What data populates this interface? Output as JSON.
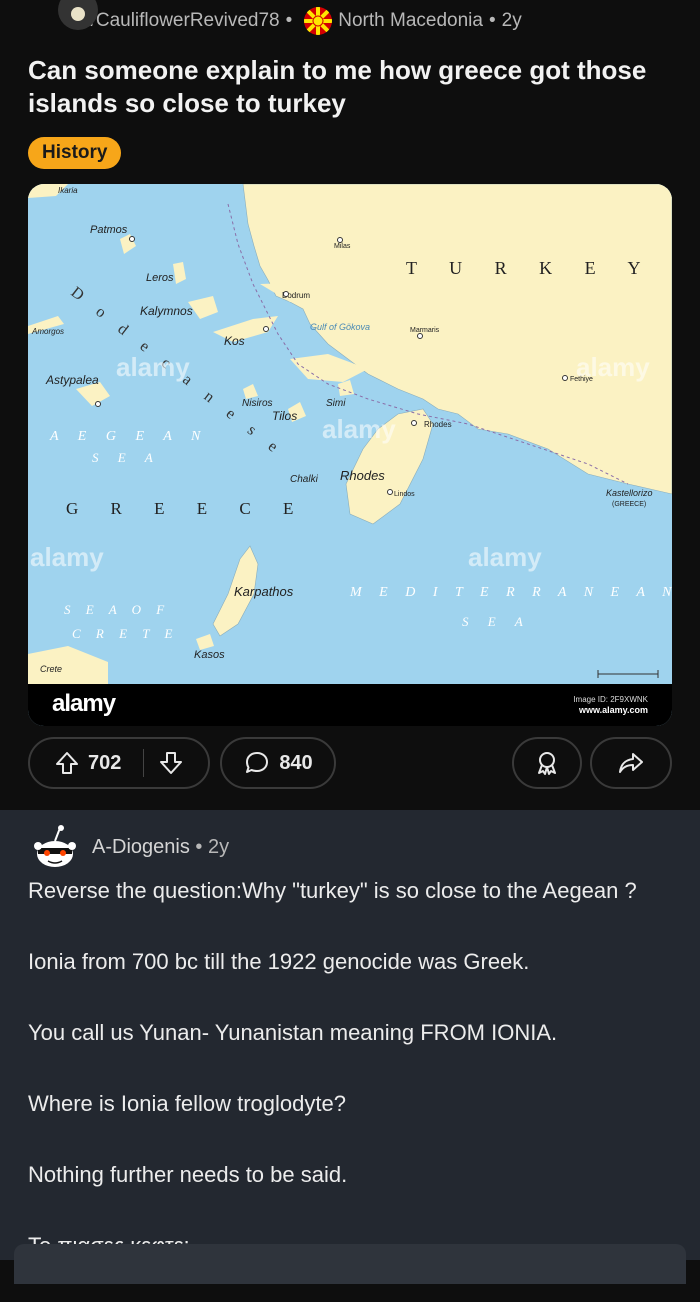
{
  "post": {
    "username": "u/CauliflowerRevived78",
    "dot": "•",
    "location": "North Macedonia",
    "age": "2y",
    "title": "Can someone explain to me how greece got those islands so close to turkey",
    "flair": "History"
  },
  "image": {
    "brand": "alamy",
    "image_id": "Image ID: 2F9XWNK",
    "site": "www.alamy.com",
    "map_labels": {
      "turkey": "T U R K E Y",
      "greece": "G R E E C E",
      "aegean": "A E G E A N",
      "aegean_sea": "S E A",
      "dodecanese": "D o d e c a n e s e",
      "mediterranean": "M E D I T E R R A N E A N",
      "mediterranean_sea": "S E A",
      "sea_of_crete_1": "S E A   O F",
      "sea_of_crete_2": "C R E T E",
      "patmos": "Patmos",
      "leros": "Leros",
      "kalymnos": "Kalymnos",
      "kos": "Kos",
      "astypalea": "Astypalea",
      "nisiros": "Nisiros",
      "tilos": "Tilos",
      "simi": "Simi",
      "rhodes": "Rhodes",
      "chalki": "Chalki",
      "karpathos": "Karpathos",
      "kasos": "Kasos",
      "crete": "Crete",
      "amorgos": "Amorgos",
      "ikaria": "Ikaria",
      "bodrum": "Bodrum",
      "marmaris": "Marmaris",
      "fethiye": "Fethiye",
      "milas": "Milas",
      "lindos": "Lindos",
      "kastellorizo": "Kastellorizo",
      "kastellorizo_sub": "(GREECE)",
      "gulf_gokova": "Gulf of Gökova",
      "rhodes_town": "Rhodes",
      "watermark": "alamy"
    }
  },
  "actions": {
    "upvotes": "702",
    "comments": "840"
  },
  "comment": {
    "username": "A-Diogenis",
    "dot": "•",
    "age": "2y",
    "paragraphs": [
      "Reverse the question:Why \"turkey\" is so close to the Aegean ?",
      "Ionia from 700 bc till the 1922 genocide was Greek.",
      "You call us Yunan- Yunanistan meaning FROM IONIA.",
      "Where is Ionia fellow troglodyte?",
      "Nothing further needs to be said.",
      "Το πιασες κεφτε;"
    ]
  },
  "colors": {
    "flair": "#f7a619",
    "sea": "#9fd3ee",
    "land": "#fbf2c3",
    "background": "#0e0e0e",
    "comment_bg": "#232830"
  }
}
